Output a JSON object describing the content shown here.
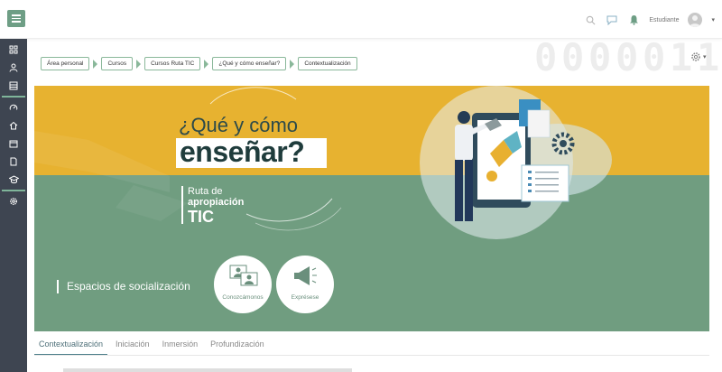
{
  "topbar": {
    "user_name": "Estudiante",
    "icons": [
      "menu-icon",
      "search-icon",
      "chat-icon",
      "bell-icon",
      "avatar-icon",
      "caret-down-icon"
    ]
  },
  "sidebar": {
    "items": [
      {
        "icon": "sitemap-icon"
      },
      {
        "icon": "users-icon"
      },
      {
        "icon": "grades-icon"
      },
      {
        "icon": "dashboard-icon"
      },
      {
        "icon": "home-icon"
      },
      {
        "icon": "calendar-icon"
      },
      {
        "icon": "files-icon"
      },
      {
        "icon": "graduation-cap-icon"
      },
      {
        "icon": "settings-icon"
      }
    ]
  },
  "breadcrumb": [
    "Área personal",
    "Cursos",
    "Cursos Ruta TIC",
    "¿Qué y cómo enseñar?",
    "Contextualización"
  ],
  "banner": {
    "title_line1": "¿Qué y cómo",
    "title_line2": "enseñar?",
    "ruta_1": "Ruta de",
    "ruta_2": "apropiación",
    "ruta_3": "TIC",
    "espacios_label": "Espacios de socialización",
    "circle_1": "Conozcámonos",
    "circle_2": "Exprésese"
  },
  "tabs": [
    "Contextualización",
    "Iniciación",
    "Inmersión",
    "Profundización"
  ],
  "active_tab": "Contextualización",
  "colors": {
    "sidebar": "#3e4551",
    "accent_green": "#6e9e85",
    "banner_yellow": "#e7b230",
    "banner_green": "#709d80",
    "title_dark": "#1f3c3c"
  }
}
